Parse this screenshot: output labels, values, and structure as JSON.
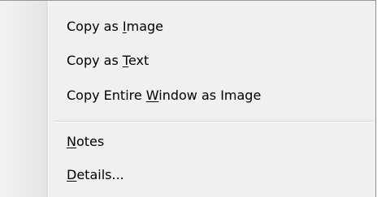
{
  "context_menu": {
    "items": [
      {
        "pre": "Copy as ",
        "acc": "I",
        "post": "mage"
      },
      {
        "pre": "Copy as ",
        "acc": "T",
        "post": "ext"
      },
      {
        "pre": "Copy Entire ",
        "acc": "W",
        "post": "indow as Image"
      },
      {
        "pre": "",
        "acc": "N",
        "post": "otes"
      },
      {
        "pre": "",
        "acc": "D",
        "post": "etails..."
      }
    ]
  }
}
